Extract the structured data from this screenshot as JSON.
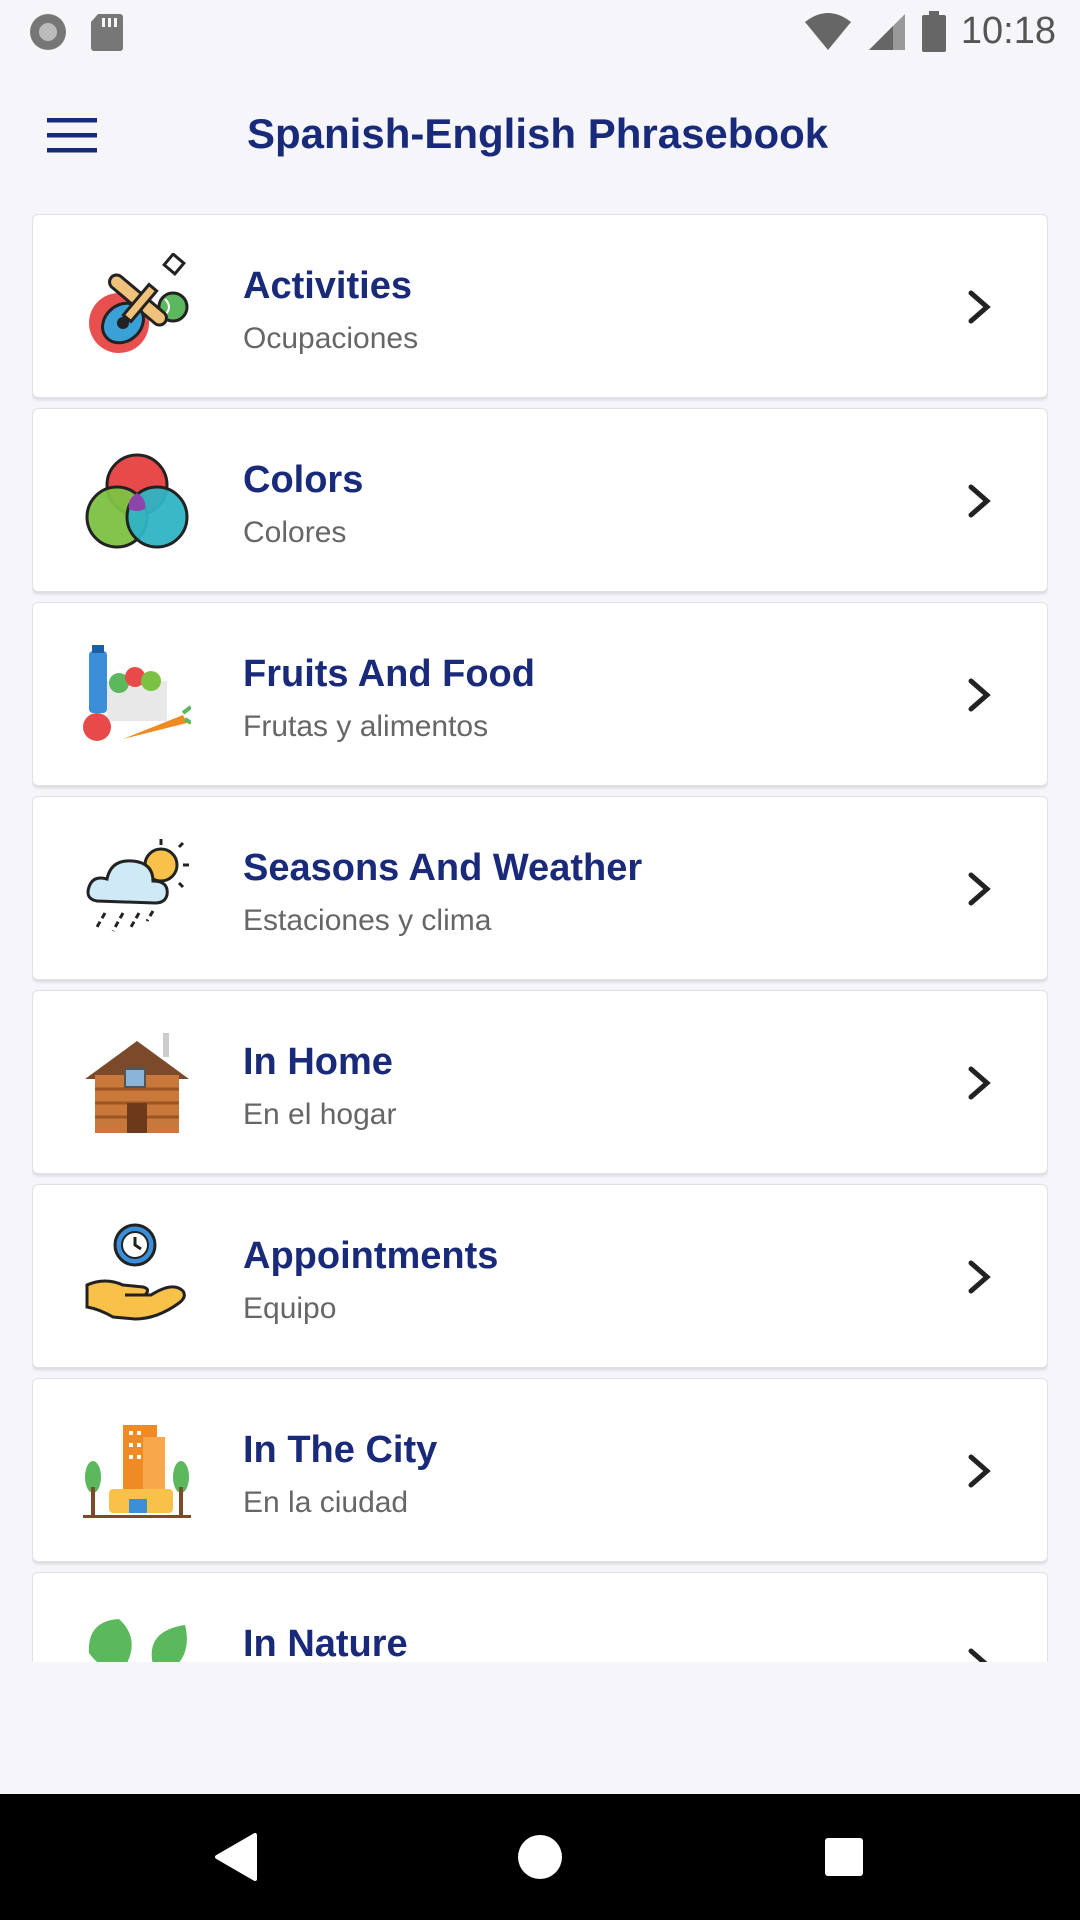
{
  "status_bar": {
    "time": "10:18",
    "icons": [
      "record-icon",
      "sd-card-icon",
      "wifi-icon",
      "signal-icon",
      "battery-icon"
    ]
  },
  "app_bar": {
    "title": "Spanish-English Phrasebook",
    "menu_icon": "hamburger-menu-icon"
  },
  "categories": [
    {
      "title": "Activities",
      "subtitle": "Ocupaciones",
      "icon": "activities-icon"
    },
    {
      "title": "Colors",
      "subtitle": "Colores",
      "icon": "colors-icon"
    },
    {
      "title": "Fruits And Food",
      "subtitle": "Frutas y alimentos",
      "icon": "fruits-food-icon"
    },
    {
      "title": "Seasons And Weather",
      "subtitle": "Estaciones y clima",
      "icon": "weather-icon"
    },
    {
      "title": "In Home",
      "subtitle": "En el hogar",
      "icon": "home-icon"
    },
    {
      "title": "Appointments",
      "subtitle": "Equipo",
      "icon": "appointments-icon"
    },
    {
      "title": "In The City",
      "subtitle": "En la ciudad",
      "icon": "city-icon"
    },
    {
      "title": "In Nature",
      "subtitle": "",
      "icon": "nature-icon"
    }
  ],
  "nav_bar": {
    "icons": [
      "back-icon",
      "home-circle-icon",
      "recents-icon"
    ]
  },
  "colors": {
    "title": "#1a2a7a",
    "subtitle": "#666666",
    "background": "#f6f6fa"
  }
}
